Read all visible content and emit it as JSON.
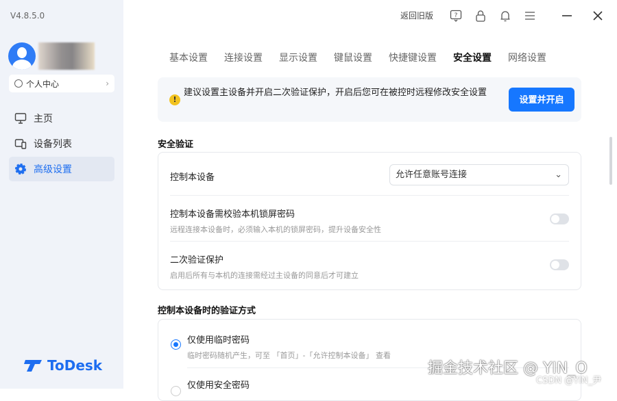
{
  "sidebar": {
    "version": "V4.8.5.0",
    "profile": "个人中心",
    "items": [
      {
        "label": "主页"
      },
      {
        "label": "设备列表"
      },
      {
        "label": "高级设置"
      }
    ],
    "logo": "ToDesk"
  },
  "topbar": {
    "old_version": "返回旧版"
  },
  "tabs": [
    "基本设置",
    "连接设置",
    "显示设置",
    "键鼠设置",
    "快捷键设置",
    "安全设置",
    "网络设置"
  ],
  "notice": {
    "text": "建议设置主设备并开启二次验证保护，开启后您可在被控时远程修改安全设置",
    "button": "设置并开启"
  },
  "security": {
    "title": "安全验证",
    "control_label": "控制本设备",
    "control_value": "允许任意账号连接",
    "lock_title": "控制本设备需校验本机锁屏密码",
    "lock_desc": "远程连接本设备时，必须输入本机的锁屏密码，提升设备安全性",
    "lock_on": false,
    "twofa_title": "二次验证保护",
    "twofa_desc": "启用后所有与本机的连接需经过主设备的同意后才可建立",
    "twofa_on": false
  },
  "verify": {
    "title": "控制本设备时的验证方式",
    "options": [
      {
        "title": "仅使用临时密码",
        "desc": "临时密码随机产生，可至 「首页」-「允许控制本设备」 查看",
        "selected": true
      },
      {
        "title": "仅使用安全密码",
        "selected": false
      }
    ]
  },
  "watermark": {
    "main": "掘金技术社区 @ YIN_O",
    "sub": "CSDN @YIN_尹"
  }
}
